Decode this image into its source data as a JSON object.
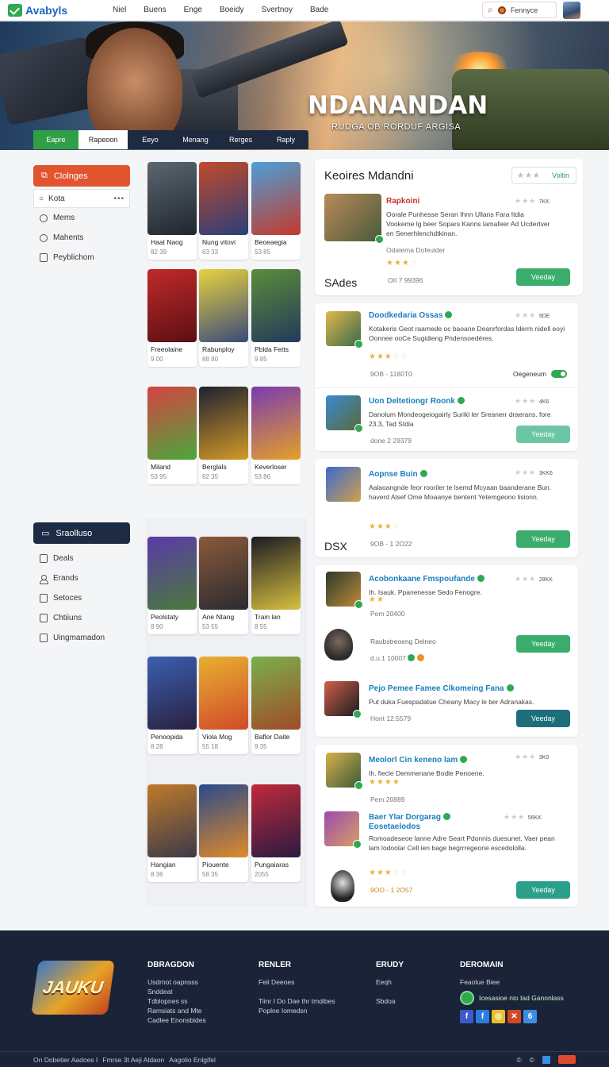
{
  "nav": {
    "logo": "Avabyls",
    "links": [
      "Niel",
      "Buens",
      "Enge",
      "Boeidy",
      "Svertnoy",
      "Bade"
    ],
    "search_text": "Fennyce"
  },
  "hero": {
    "title": "NDANANDAN",
    "subtitle": "RUDGA OB RORDUF ARGISA",
    "tabs": [
      "Eapre",
      "Rapeoon",
      "Eeyo",
      "Menang",
      "Rerges",
      "Raply"
    ]
  },
  "sidebar": {
    "primary_button": "Clolnges",
    "search": "Kota",
    "search_more": "•••",
    "items": [
      "Mems",
      "Mahents",
      "Peyblichom"
    ],
    "secondary_button": "Sraolluso",
    "items2": [
      "Deals",
      "Erands",
      "Setoces",
      "Chtiiuns",
      "Uingmamadon"
    ]
  },
  "grid": [
    {
      "name": "Haat Naog",
      "size": "82 39",
      "colors": [
        "#5b6770",
        "#20262d"
      ]
    },
    {
      "name": "Nung vitovi",
      "size": "63 33",
      "colors": [
        "#c24a2a",
        "#2a3f78"
      ]
    },
    {
      "name": "Beoeaegia",
      "size": "53 85",
      "colors": [
        "#4aa0d8",
        "#c43a2b"
      ]
    },
    {
      "name": "Freeolaine",
      "size": "9 00",
      "colors": [
        "#c12a2a",
        "#5a0f14"
      ]
    },
    {
      "name": "Rabunploy",
      "size": "88 80",
      "colors": [
        "#e8d23e",
        "#3a4a7a"
      ]
    },
    {
      "name": "Pblda Fetts",
      "size": "9 85",
      "colors": [
        "#5b8d3a",
        "#24395a"
      ]
    },
    {
      "name": "Miland",
      "size": "53 95",
      "colors": [
        "#d64242",
        "#4aa83c"
      ]
    },
    {
      "name": "Berglals",
      "size": "82 35",
      "colors": [
        "#1e2030",
        "#d49a28"
      ]
    },
    {
      "name": "Keverloser",
      "size": "53 86",
      "colors": [
        "#7a3ab0",
        "#e5a028"
      ]
    },
    {
      "name": "Peolstaty",
      "size": "8 90",
      "colors": [
        "#5a3aa8",
        "#4a7a3a"
      ]
    },
    {
      "name": "Ane Ntang",
      "size": "53 55",
      "colors": [
        "#8a5a3a",
        "#2a2a30"
      ]
    },
    {
      "name": "Train lan",
      "size": "8 55",
      "colors": [
        "#1a1a22",
        "#d8c040"
      ]
    },
    {
      "name": "Penoopida",
      "size": "8 28",
      "colors": [
        "#3a60b0",
        "#2a2040"
      ]
    },
    {
      "name": "Viola Mog",
      "size": "55 18",
      "colors": [
        "#e8b030",
        "#d04a2a"
      ]
    },
    {
      "name": "Baflor Daite",
      "size": "9 35",
      "colors": [
        "#7ab04a",
        "#a04a2a"
      ]
    },
    {
      "name": "Hangian",
      "size": "8 36",
      "colors": [
        "#c07a2a",
        "#3a3a4a"
      ]
    },
    {
      "name": "Piouente",
      "size": "58 35",
      "colors": [
        "#2a4a8a",
        "#e08a2a"
      ]
    },
    {
      "name": "Pungaiaras",
      "size": "2055",
      "colors": [
        "#c02a3a",
        "#2a1a40"
      ]
    }
  ],
  "feed": {
    "title": "Keoires Mdandni",
    "value_label": "Voltin",
    "value_stars": "★★★",
    "section_label": "SAdes",
    "section_label_2": "DSX",
    "featured": {
      "name": "Rapkoini",
      "desc": "Oorale Punhesse Seran Ihnn Ullans Fara Itdia Vookeme lg beer Sopars Kanns lamafeer Ad Ucdertver en Senerhlenchdtkinan.",
      "sub": "Odatema Dofeulder",
      "stars": "★★★",
      "stars_off": "☆",
      "meta": "OII  7 99396",
      "rating": "★★★",
      "rating_num": "7KK",
      "button": "Veeday"
    },
    "apps": [
      {
        "name": "Doodkedaria Ossas",
        "desc": "Kotakeris Geot raamede oc baoane Deanrfordas lderm nidell eoyi Oonnee ooCe Sugidieng Pndensoedères.",
        "stars": "★★★",
        "stars_off": "☆☆",
        "meta": "9OB -  1180T0",
        "rating": "★★★",
        "rating_num": "9DE",
        "extra": "Oegeneum",
        "button": ""
      },
      {
        "name": "Uon Deltetiongr Roonk",
        "desc": "Danolum Mondeogeiogairly Surikl ler Sreanerr draerans. fore 23.3, Tad Stdia",
        "stars": "",
        "stars_off": "",
        "meta": "done   2 29379",
        "rating": "★★★",
        "rating_num": "4K6",
        "extra": "",
        "button": "Yeeday"
      },
      {
        "name": "Aopnse Buin",
        "desc": "Aalaoangnde feor rooriler te lsemd Mcyaan baanderane Bun. haverd Alsef Ome Moaanye bentent Yetemgeono lisionn.",
        "stars": "★★★",
        "stars_off": "☆",
        "meta": "9OB - 1 2O22",
        "rating": "★★★",
        "rating_num": "3KK6",
        "extra": "",
        "button": "Yeeday"
      },
      {
        "name": "Acobonkaane Fmspoufande",
        "desc": "Ih. Isauk. Ppanenesse Sedo Fenogre.",
        "stars": "★★",
        "stars_off": "",
        "meta": "Pem  20400",
        "rating": "★★★",
        "rating_num": "28KK",
        "extra": "",
        "button": ""
      },
      {
        "name": "",
        "desc": "Raubstreoeng Delneo",
        "stars": "",
        "stars_off": "",
        "meta": "d.u.1  10007",
        "rating": "",
        "rating_num": "",
        "extra": "",
        "button": "Yeeday"
      },
      {
        "name": "Pejo Pemee Famee Clkomeing Fana",
        "desc": "Put duka Fuespadatue Cheany Macy le ber Adranakas.",
        "stars": "",
        "stars_off": "",
        "meta": "Hont  12:5579",
        "rating": "",
        "rating_num": "",
        "extra": "",
        "button": "Veeday"
      },
      {
        "name": "Meolorl Cin keneno lam",
        "desc": "Ih. fiecle Demmenane Bodle Penoene.",
        "stars": "★★★★",
        "stars_off": "",
        "meta": "Pem  20889",
        "rating": "★★★",
        "rating_num": "3K0",
        "extra": "",
        "button": ""
      },
      {
        "name": "Baer Ylar Dorgarag",
        "name2": "Eosetaelodos",
        "desc": "Romoadeseoe lanne Adre Seart Pdonnis duesunet. Vaer pean lam lodoolar Cell ien bage begrrregeone escedololla.",
        "stars": "★★★",
        "stars_off": "☆☆",
        "meta": "9OO  - 1 2O57",
        "rating": "★★★",
        "rating_num": "56KK",
        "extra": "",
        "button": "Yeeday"
      }
    ]
  },
  "footer": {
    "logo": "JAUKU",
    "col1": {
      "title": "DBRAGDON",
      "lines": [
        "Usdrnot oapnsss",
        "Snddeat",
        "Tdblopnes ss",
        "Ramsiats and Mte",
        "Cadlee Enonsbides"
      ]
    },
    "col2": {
      "title": "RENLER",
      "lines": [
        "Feil Deeoes",
        "",
        "Tiinr I Do Dae thr tmdibes",
        "Poplne Iomedsn"
      ]
    },
    "col3": {
      "title": "ERUDY",
      "lines": [
        "Eeqh",
        "",
        "Sbdoa"
      ]
    },
    "col4": {
      "title": "DEROMAIN",
      "lines": [
        "Feaolue Biee"
      ]
    },
    "badge": "Icesasioe nio Iad Ganonlass",
    "social": [
      "f",
      "f",
      "◎",
      "✕",
      "6"
    ],
    "social_colors": [
      "#3b5bcc",
      "#2d7de0",
      "#e8c12a",
      "#d04a2a",
      "#3b8ee0"
    ],
    "bottom_text": [
      "On Dobetier Aadoes I",
      "Fmrse 3t Aeji Aldaon",
      "Aagolio Enlgifel"
    ],
    "bottom_icons": [
      "©",
      "©"
    ]
  }
}
